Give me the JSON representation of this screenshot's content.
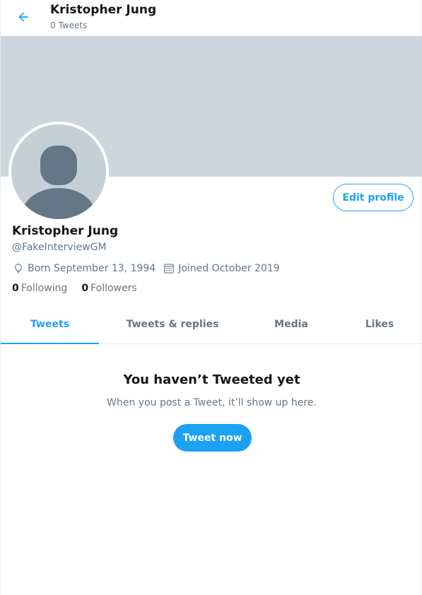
{
  "header": {
    "title": "Kristopher Jung",
    "tweet_count": "0 Tweets"
  },
  "profile": {
    "name": "Kristopher Jung",
    "handle": "@FakeInterviewGM",
    "born": "Born September 13, 1994",
    "joined": "Joined October 2019",
    "following_count": "0",
    "following_label": "Following",
    "followers_count": "0",
    "followers_label": "Followers",
    "edit_label": "Edit profile"
  },
  "tabs": [
    {
      "label": "Tweets",
      "active": true
    },
    {
      "label": "Tweets & replies",
      "active": false
    },
    {
      "label": "Media",
      "active": false
    },
    {
      "label": "Likes",
      "active": false
    }
  ],
  "empty_state": {
    "title": "You haven’t Tweeted yet",
    "subtitle": "When you post a Tweet, it’ll show up here.",
    "button_label": "Tweet now"
  },
  "icons": {
    "back": "arrow-left-icon",
    "birthday": "balloon-icon",
    "joined": "calendar-icon"
  },
  "colors": {
    "accent": "#1da1f2",
    "banner": "#ccd6dd",
    "secondary_text": "#657786"
  }
}
